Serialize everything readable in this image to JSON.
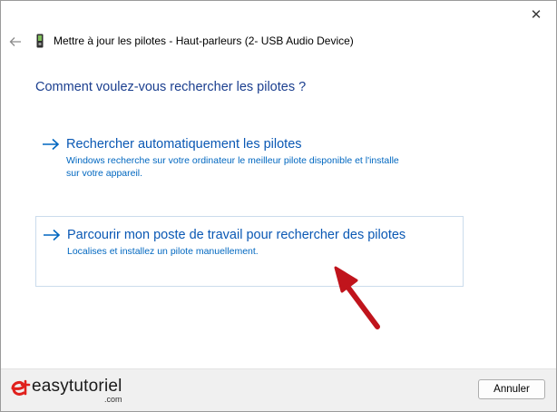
{
  "window": {
    "title": "Mettre à jour les pilotes - Haut-parleurs (2- USB Audio Device)",
    "close_glyph": "✕"
  },
  "main": {
    "question": "Comment voulez-vous rechercher les pilotes ?",
    "options": [
      {
        "title": "Rechercher automatiquement les pilotes",
        "description": "Windows recherche sur votre ordinateur le meilleur pilote disponible et l'installe\nsur votre appareil."
      },
      {
        "title": "Parcourir mon poste de travail pour rechercher des pilotes",
        "description": "Localises et installez un pilote manuellement."
      }
    ]
  },
  "footer": {
    "logo_text": "easytutoriel",
    "logo_sub": ".com",
    "cancel_label": "Annuler"
  },
  "colors": {
    "accent": "#0067c0",
    "heading": "#1b3f8f",
    "annotation_arrow": "#c0141c"
  },
  "icons": {
    "back": "back-arrow-icon",
    "device": "usb-device-icon",
    "option_arrow": "right-arrow-icon",
    "close": "close-icon"
  }
}
